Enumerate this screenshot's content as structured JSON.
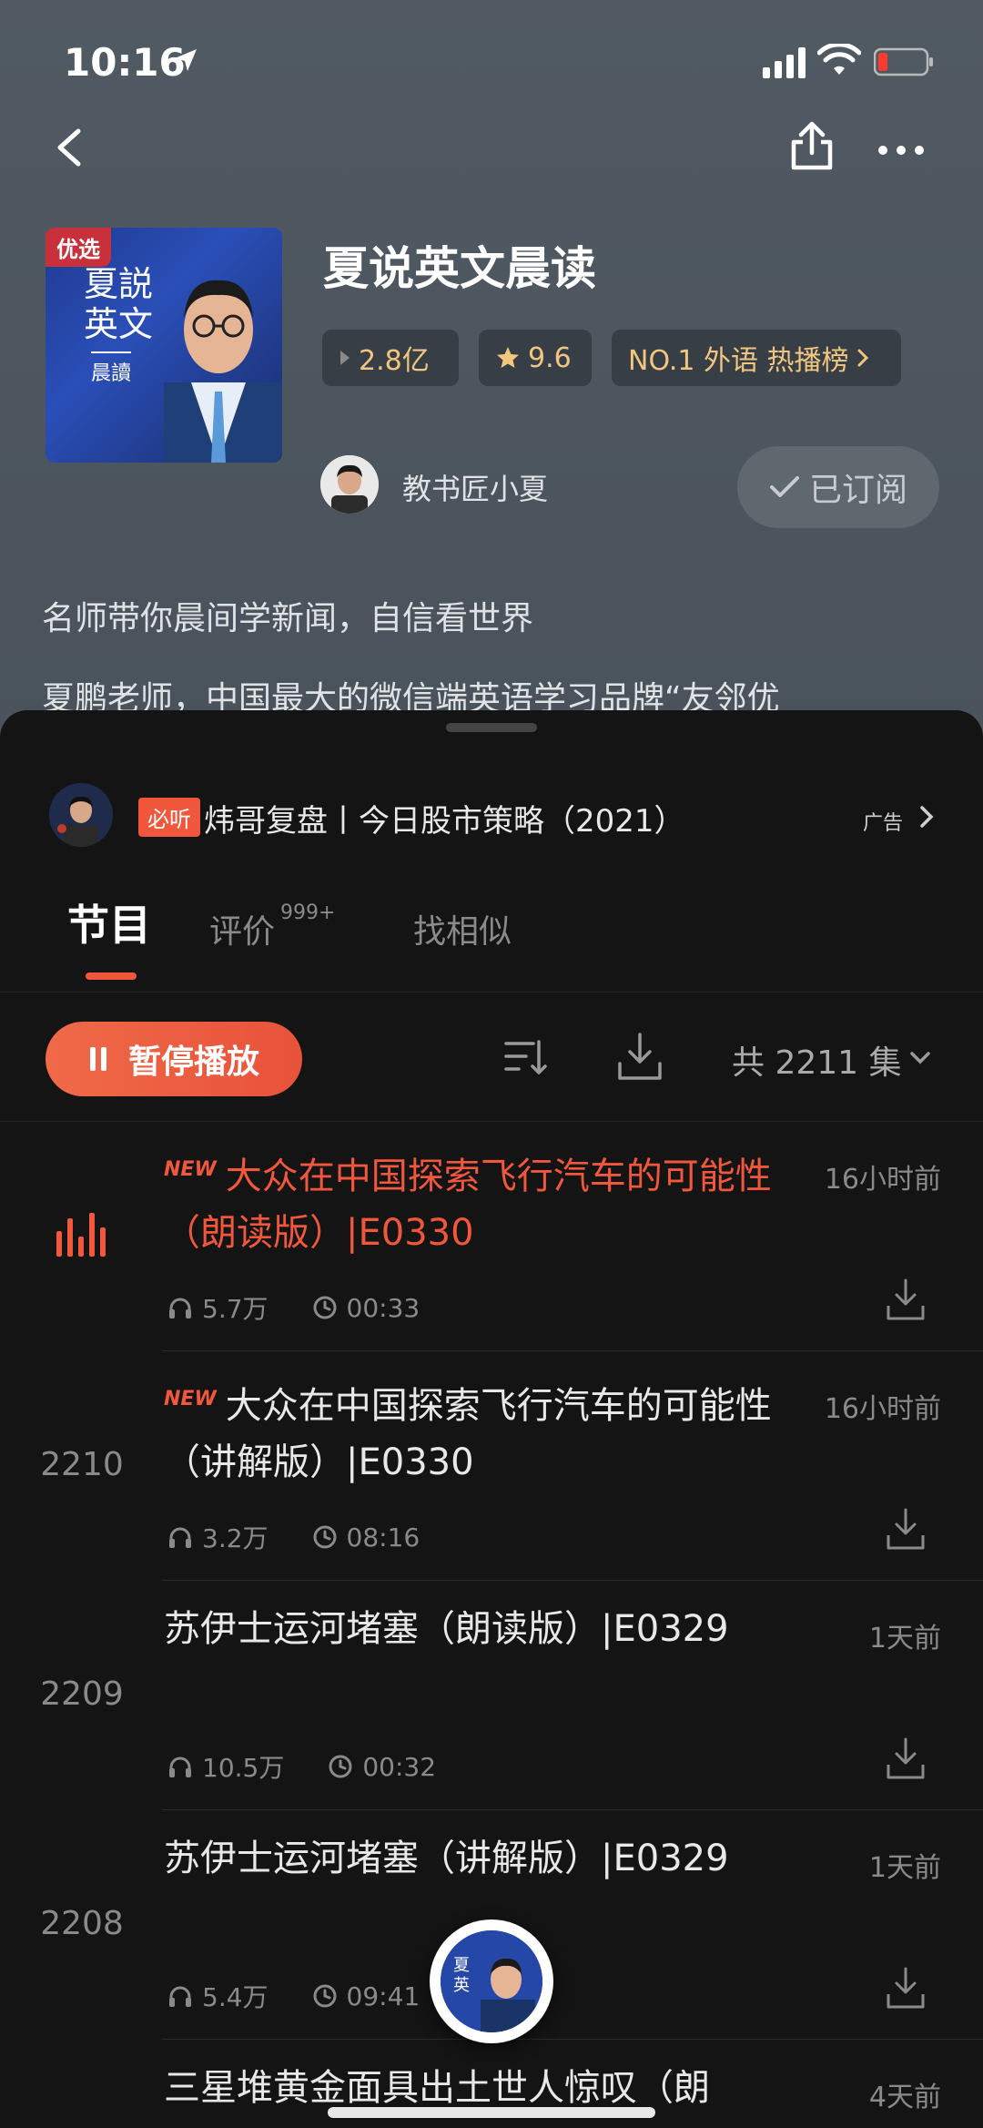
{
  "status_bar": {
    "time": "10:16"
  },
  "album": {
    "title": "夏说英文晨读",
    "cover_tag": "优选",
    "cover_text": "夏説英文",
    "cover_sub": "晨讀",
    "plays": "2.8亿",
    "rating": "9.6",
    "rank": "NO.1 外语 热播榜",
    "author": "教书匠小夏",
    "subscribe_label": "已订阅",
    "description_1": "名师带你晨间学新闻，自信看世界",
    "description_2": "夏鹏老师，中国最大的微信端英语学习品牌“友邻优"
  },
  "ad": {
    "tag": "必听",
    "title": "炜哥复盘丨今日股市策略（2021）",
    "label": "广告"
  },
  "tabs": {
    "episodes": "节目",
    "reviews": "评价",
    "reviews_count": "999+",
    "similar": "找相似"
  },
  "controls": {
    "pause_label": "暂停播放",
    "episode_count": "共 2211 集"
  },
  "episodes": [
    {
      "num": "",
      "new": "NEW",
      "title": "大众在中国探索飞行汽车的可能性（朗读版）|E0330",
      "time": "16小时前",
      "plays": "5.7万",
      "duration": "00:33"
    },
    {
      "num": "2210",
      "new": "NEW",
      "title": "大众在中国探索飞行汽车的可能性（讲解版）|E0330",
      "time": "16小时前",
      "plays": "3.2万",
      "duration": "08:16"
    },
    {
      "num": "2209",
      "new": "",
      "title": "苏伊士运河堵塞（朗读版）|E0329",
      "time": "1天前",
      "plays": "10.5万",
      "duration": "00:32"
    },
    {
      "num": "2208",
      "new": "",
      "title": "苏伊士运河堵塞（讲解版）|E0329",
      "time": "1天前",
      "plays": "5.4万",
      "duration": "09:41"
    },
    {
      "num": "",
      "new": "",
      "title": "三星堆黄金面具出土世人惊叹（朗",
      "time": "4天前",
      "plays": "",
      "duration": ""
    }
  ],
  "colors": {
    "accent": "#f0573c",
    "gold": "#f1c780",
    "sheet_bg": "#141414",
    "header_bg": "#4a535b"
  }
}
